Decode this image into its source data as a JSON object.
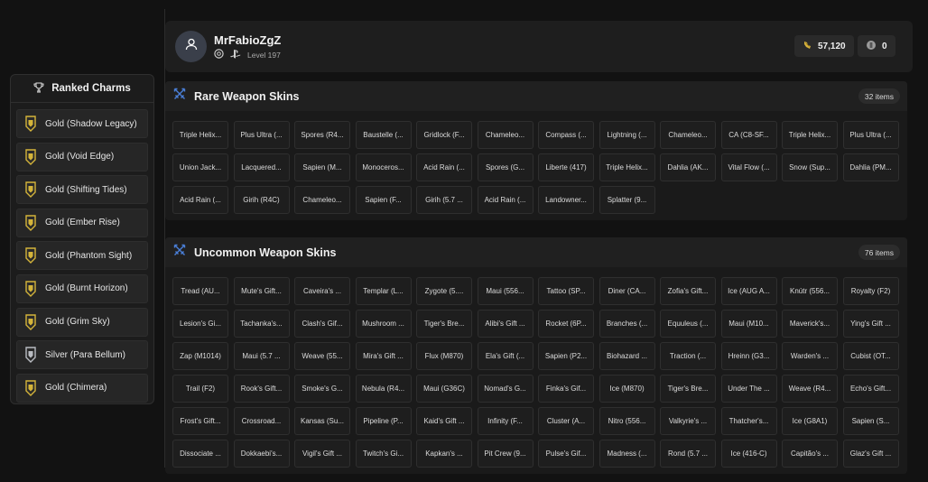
{
  "sidebar": {
    "title": "Ranked Charms",
    "charms": [
      {
        "label": "Gold (Shadow Legacy)",
        "tier": "gold"
      },
      {
        "label": "Gold (Void Edge)",
        "tier": "gold"
      },
      {
        "label": "Gold (Shifting Tides)",
        "tier": "gold"
      },
      {
        "label": "Gold (Ember Rise)",
        "tier": "gold"
      },
      {
        "label": "Gold (Phantom Sight)",
        "tier": "gold"
      },
      {
        "label": "Gold (Burnt Horizon)",
        "tier": "gold"
      },
      {
        "label": "Gold (Grim Sky)",
        "tier": "gold"
      },
      {
        "label": "Silver (Para Bellum)",
        "tier": "silver"
      },
      {
        "label": "Gold (Chimera)",
        "tier": "gold"
      }
    ]
  },
  "profile": {
    "username": "MrFabioZgZ",
    "level": "Level 197",
    "renown": "57,120",
    "credits": "0",
    "icons": [
      "user-icon",
      "ubisoft-icon",
      "playstation-icon",
      "renown-icon",
      "r6-credits-icon"
    ]
  },
  "rare": {
    "title": "Rare Weapon Skins",
    "count": "32 items",
    "items": [
      "Triple Helix...",
      "Plus Ultra (...",
      "Spores (R4...",
      "Baustelle (...",
      "Gridlock (F...",
      "Chameleo...",
      "Compass (...",
      "Lightning (...",
      "Chameleo...",
      "CA (C8-SF...",
      "Triple Helix...",
      "Plus Ultra (...",
      "Union Jack...",
      "Lacquered...",
      "Sapien (M...",
      "Monoceros...",
      "Acid Rain (...",
      "Spores (G...",
      "Liberte (417)",
      "Triple Helix...",
      "Dahlia (AK...",
      "Vital Flow (...",
      "Snow (Sup...",
      "Dahlia (PM...",
      "Acid Rain (...",
      "Girih (R4C)",
      "Chameleo...",
      "Sapien (F...",
      "Girih (5.7 ...",
      "Acid Rain (...",
      "Landowner...",
      "Splatter (9..."
    ]
  },
  "uncommon": {
    "title": "Uncommon Weapon Skins",
    "count": "76 items",
    "items": [
      "Tread (AU...",
      "Mute's Gift...",
      "Caveira's ...",
      "Templar (L...",
      "Zygote (5....",
      "Maui (556...",
      "Tattoo (SP...",
      "Diner (CA...",
      "Zofia's Gift...",
      "Ice (AUG A...",
      "Knútr (556...",
      "Royalty (F2)",
      "Lesion's Gi...",
      "Tachanka's...",
      "Clash's Gif...",
      "Mushroom ...",
      "Tiger's Bre...",
      "Alibi's Gift ...",
      "Rocket (6P...",
      "Branches (...",
      "Equuleus (...",
      "Maui (M10...",
      "Maverick's...",
      "Ying's Gift ...",
      "Zap (M1014)",
      "Maui (5.7 ...",
      "Weave (55...",
      "Mira's Gift ...",
      "Flux (M870)",
      "Ela's Gift (...",
      "Sapien (P2...",
      "Biohazard ...",
      "Traction (...",
      "Hreinn (G3...",
      "Warden's ...",
      "Cubist (OT...",
      "Trail (F2)",
      "Rook's Gift...",
      "Smoke's G...",
      "Nebula (R4...",
      "Maui (G36C)",
      "Nomad's G...",
      "Finka's Gif...",
      "Ice (M870)",
      "Tiger's Bre...",
      "Under The ...",
      "Weave (R4...",
      "Echo's Gift...",
      "Frost's Gift...",
      "Crossroad...",
      "Kansas (Su...",
      "Pipeline (P...",
      "Kaid's Gift ...",
      "Infinity (F...",
      "Cluster (A...",
      "Nitro (556...",
      "Valkyrie's ...",
      "Thatcher's...",
      "Ice (G8A1)",
      "Sapien (S...",
      "Dissociate ...",
      "Dokkaebi's...",
      "Vigil's Gift ...",
      "Twitch's Gi...",
      "Kapkan's ...",
      "Pit Crew (9...",
      "Pulse's Gif...",
      "Madness (...",
      "Rond (5.7 ...",
      "Ice (416-C)",
      "Capitão's ...",
      "Glaz's Gift ..."
    ]
  },
  "colors": {
    "accent_blue": "#4a7fd8",
    "gold_charm": "#d4b43a",
    "silver_charm": "#b9bcc2"
  }
}
